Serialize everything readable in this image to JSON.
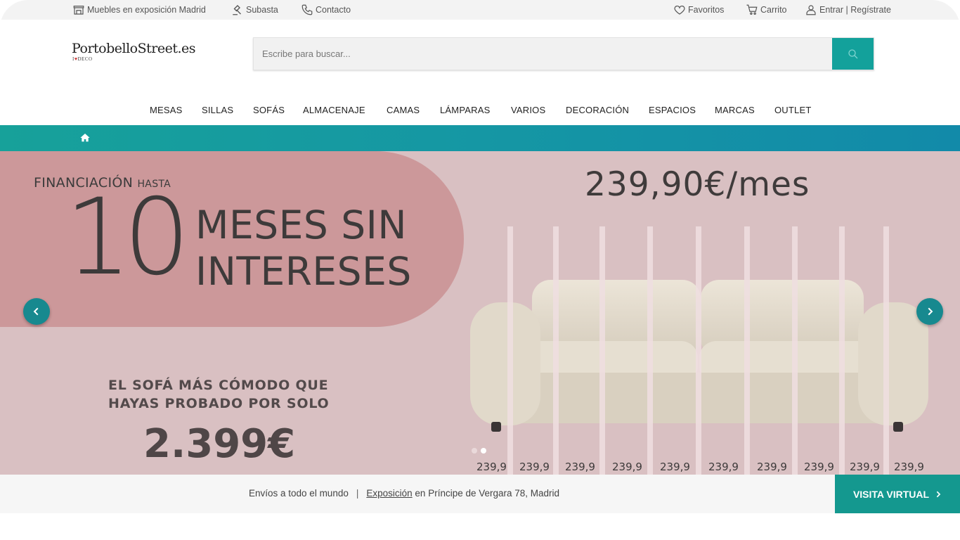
{
  "topbar": {
    "showroom_label": "Muebles en exposición Madrid",
    "auction_label": "Subasta",
    "contact_label": "Contacto",
    "favorites_label": "Favoritos",
    "cart_label": "Carrito",
    "login_label": "Entrar | Regístrate"
  },
  "header": {
    "logo_text": "PortobelloStreet.es",
    "logo_tagline_prefix": "I",
    "logo_tagline_suffix": "DECO",
    "search_placeholder": "Escribe para buscar..."
  },
  "nav": {
    "items": [
      "MESAS",
      "SILLAS",
      "SOFÁS",
      "ALMACENAJE",
      "CAMAS",
      "LÁMPARAS",
      "VARIOS",
      "DECORACIÓN",
      "ESPACIOS",
      "MARCAS",
      "OUTLET"
    ]
  },
  "hero": {
    "financing_label": "FINANCIACIÓN",
    "financing_small": "HASTA",
    "big_number": "10",
    "headline_line1": "MESES SIN",
    "headline_line2": "INTERESES",
    "slogan_line1": "EL SOFÁ MÁS CÓMODO QUE",
    "slogan_line2": "HAYAS PROBADO POR SOLO",
    "price": "2.399€",
    "monthly_price": "239,90€/mes",
    "stripe_labels": [
      "239,9",
      "239,9",
      "239,9",
      "239,9",
      "239,9",
      "239,9",
      "239,9",
      "239,9",
      "239,9",
      "239,9"
    ],
    "slide_count": 2,
    "active_slide": 2
  },
  "bottombar": {
    "shipping_text": "Envíos a todo el mundo",
    "separator": "|",
    "exhibition_link": "Exposición",
    "exhibition_rest": "en Príncipe de Vergara 78, Madrid",
    "virtual_visit_label": "VISITA VIRTUAL"
  },
  "colors": {
    "accent_teal": "#13a19b",
    "hero_background": "#d9c0c2",
    "hero_pink_shape": "#cc989a",
    "arrow_button": "#17898f"
  }
}
